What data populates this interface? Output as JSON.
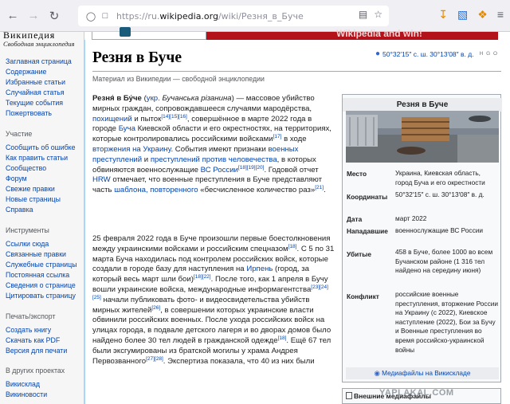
{
  "browser": {
    "url_prefix": "https://ru.",
    "url_domain": "wikipedia.org",
    "url_path": "/wiki/Резня_в_Буче"
  },
  "icons": {
    "back": "arrow-left-icon",
    "forward": "arrow-right-icon",
    "reload": "reload-icon",
    "shield": "shield-icon",
    "lock": "lock-icon",
    "reader": "reader-view-icon",
    "bookmark": "star-icon",
    "download": "download-icon",
    "extension": "extension-icon",
    "menu": "hamburger-menu-icon"
  },
  "logo": {
    "title": "Википедия",
    "subtitle": "Свободная энциклопедия"
  },
  "sidebar": {
    "nav": [
      "Заглавная страница",
      "Содержание",
      "Избранные статьи",
      "Случайная статья",
      "Текущие события",
      "Пожертвовать"
    ],
    "participate_head": "Участие",
    "participate": [
      "Сообщить об ошибке",
      "Как править статьи",
      "Сообщество",
      "Форум",
      "Свежие правки",
      "Новые страницы",
      "Справка"
    ],
    "tools_head": "Инструменты",
    "tools": [
      "Ссылки сюда",
      "Связанные правки",
      "Служебные страницы",
      "Постоянная ссылка",
      "Сведения о странице",
      "Цитировать страницу"
    ],
    "print_head": "Печать/экспорт",
    "print": [
      "Создать книгу",
      "Скачать как PDF",
      "Версия для печати"
    ],
    "projects_head": "В других проектах",
    "projects": [
      "Викисклад",
      "Викиновости"
    ]
  },
  "banner": {
    "text": "Wikipedia and win!"
  },
  "article": {
    "title": "Резня в Буче",
    "coordinates": "50°32′15″ с. ш. 30°13′08″ в. д.",
    "coord_extra": "H G O",
    "from": "Материал из Википедии — свободной энциклопедии"
  },
  "infobox": {
    "title": "Резня в Буче",
    "rows": [
      {
        "label": "Место",
        "value": "Украина, Киевская область, город Буча и его окрестности"
      },
      {
        "label": "Координаты",
        "value": "50°32′15″ с. ш. 30°13′08″ в. д."
      },
      {
        "label": "Дата",
        "value": "март 2022"
      },
      {
        "label": "Нападавшие",
        "value": "военнослужащие ВС России"
      },
      {
        "label": "Убитые",
        "value": "458 в Буче, более 1000 во всем Бучанском районе (1 316 тел найдено на середину июня)"
      },
      {
        "label": "Конфликт",
        "value": "российские военные преступления, вторжение России на Украину (с 2022), Киевское наступление (2022), Бои за Бучу и Военные преступления во время российско-украинской войны"
      }
    ],
    "media": "Медиафайлы на Викискладе",
    "external": "Внешние медиафайлы"
  },
  "watermark": "YAPLAKAL.COM"
}
